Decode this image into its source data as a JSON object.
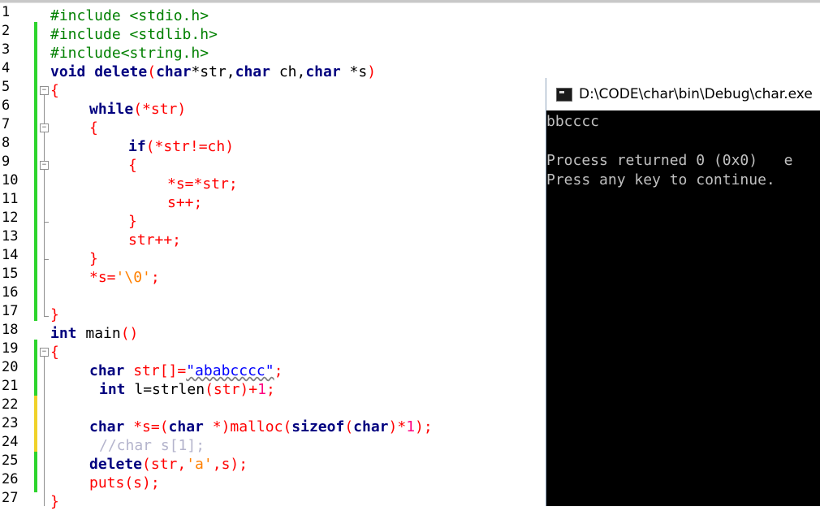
{
  "editor": {
    "line_numbers": [
      "1",
      "2",
      "3",
      "4",
      "5",
      "6",
      "7",
      "8",
      "9",
      "10",
      "11",
      "12",
      "13",
      "14",
      "15",
      "16",
      "17",
      "18",
      "19",
      "20",
      "21",
      "22",
      "23",
      "24",
      "25",
      "26",
      "27"
    ],
    "includes": [
      "#include <stdio.h>",
      "#include <stdlib.h>",
      "#include<string.h>"
    ],
    "func_decl": {
      "kw_void": "void",
      "name": "delete",
      "kw_char1": "char",
      "p1": "*str,",
      "kw_char2": "char",
      "p2": "ch,",
      "kw_char3": "char",
      "p3": "*s",
      "open": "(",
      "close": ")"
    },
    "brace_open": "{",
    "brace_close": "}",
    "while_kw": "while",
    "while_cond": "(*str)",
    "if_kw": "if",
    "if_cond": "(*str!=ch)",
    "assign": "*s=*str;",
    "s_inc": "s++;",
    "str_inc": "str++;",
    "terminate_lhs": "*s=",
    "terminate_chr": "'\\0'",
    "terminate_semi": ";",
    "main_int": "int",
    "main_name": " main",
    "main_parens": "()",
    "char_kw": "char",
    "str_decl": " str[]=",
    "str_literal": "\"ababcccc\"",
    "str_semi": ";",
    "int_kw": "int",
    "l_decl": " l=strlen",
    "l_args": "(str)",
    "l_plus": "+",
    "l_one": "1",
    "l_semi": ";",
    "s_decl_star": " *s=(",
    "s_decl_char": "char",
    "s_decl_cast": " *)malloc(",
    "sizeof_kw": "sizeof",
    "sizeof_open": "(",
    "sizeof_char": "char",
    "sizeof_close": ")*",
    "malloc_one": "1",
    "malloc_end": ");",
    "comment": "//char s[1];",
    "delete_call_kw": "delete",
    "delete_call_args1": "(str,",
    "delete_call_chr": "'a'",
    "delete_call_args2": ",s);",
    "puts_call": "puts(s);",
    "last_brace": "}"
  },
  "console": {
    "title": "D:\\CODE\\char\\bin\\Debug\\char.exe",
    "lines": [
      "bbcccc",
      "",
      "Process returned 0 (0x0)   e",
      "Press any key to continue."
    ]
  }
}
